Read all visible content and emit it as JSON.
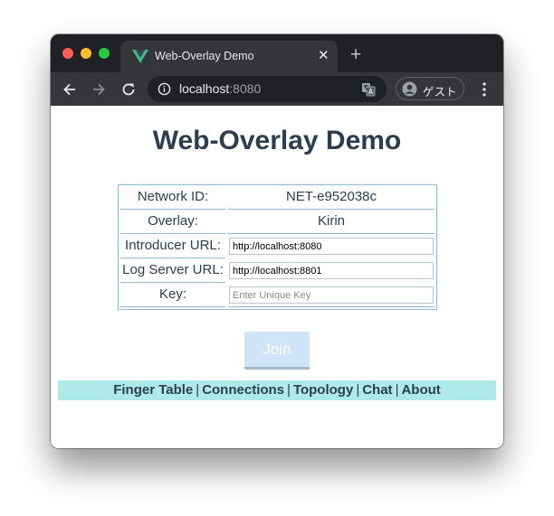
{
  "browser": {
    "tab_title": "Web-Overlay Demo",
    "url_host": "localhost",
    "url_port": ":8080",
    "profile_name": "ゲスト",
    "icons": {
      "back": "arrow-left-icon",
      "forward": "arrow-right-icon",
      "reload": "reload-icon",
      "info": "info-icon",
      "translate": "translate-icon",
      "avatar": "person-icon",
      "menu": "three-dots-icon",
      "close": "close-icon",
      "new_tab": "plus-icon",
      "favicon": "vue-logo-icon"
    }
  },
  "page": {
    "heading": "Web-Overlay Demo",
    "form": {
      "network_id_label": "Network ID:",
      "network_id_value": "NET-e952038c",
      "overlay_label": "Overlay:",
      "overlay_value": "Kirin",
      "introducer_url_label": "Introducer URL:",
      "introducer_url_value": "http://localhost:8080",
      "log_server_url_label": "Log Server URL:",
      "log_server_url_value": "http://localhost:8801",
      "key_label": "Key:",
      "key_placeholder": "Enter Unique Key",
      "key_value": ""
    },
    "join_label": "Join",
    "nav": {
      "items": [
        "Finger Table",
        "Connections",
        "Topology",
        "Chat",
        "About"
      ],
      "separator": "|"
    }
  },
  "colors": {
    "heading": "#2c3e50",
    "table_border": "#8fbcd4",
    "join_bg": "#d0e4f7",
    "nav_bg": "#aeeaea",
    "vue_green": "#42b883"
  }
}
